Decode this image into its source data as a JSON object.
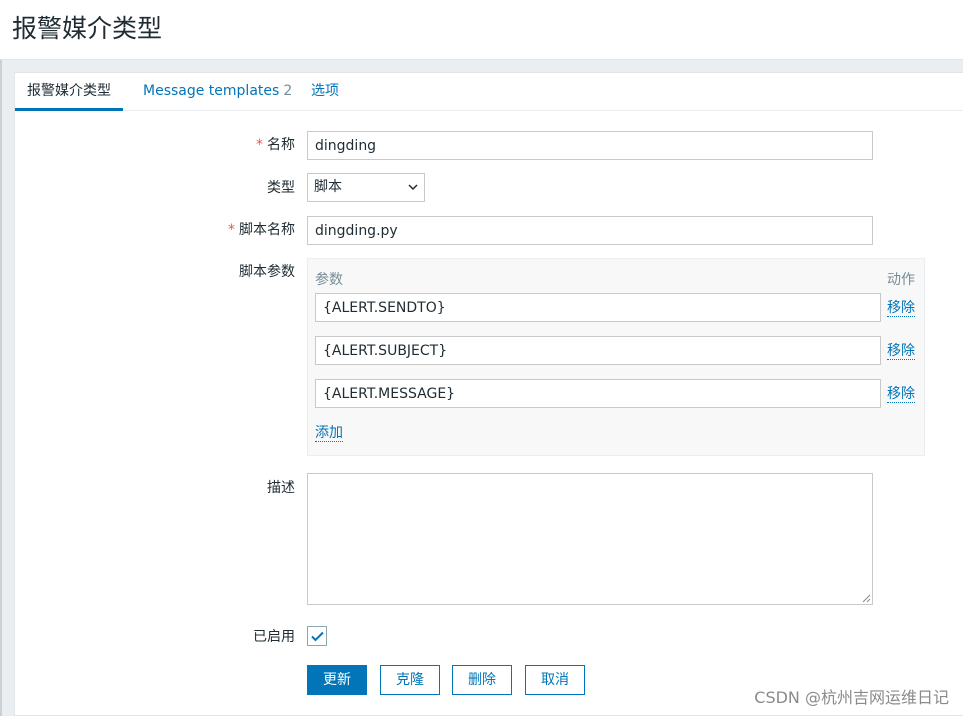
{
  "page": {
    "title": "报警媒介类型"
  },
  "tabs": [
    {
      "label": "报警媒介类型"
    },
    {
      "label": "Message templates",
      "count": "2"
    },
    {
      "label": "选项"
    }
  ],
  "form": {
    "name": {
      "label": "名称",
      "value": "dingding"
    },
    "type": {
      "label": "类型",
      "value": "脚本"
    },
    "script_name": {
      "label": "脚本名称",
      "value": "dingding.py"
    },
    "script_params": {
      "label": "脚本参数",
      "col_param": "参数",
      "col_action": "动作",
      "items": [
        {
          "value": "{ALERT.SENDTO}",
          "action": "移除"
        },
        {
          "value": "{ALERT.SUBJECT}",
          "action": "移除"
        },
        {
          "value": "{ALERT.MESSAGE}",
          "action": "移除"
        }
      ],
      "add_label": "添加"
    },
    "description": {
      "label": "描述",
      "value": ""
    },
    "enabled": {
      "label": "已启用",
      "checked": true
    }
  },
  "buttons": {
    "update": "更新",
    "clone": "克隆",
    "delete": "删除",
    "cancel": "取消"
  },
  "watermark": "CSDN @杭州吉网运维日记",
  "colors": {
    "accent": "#0275b8",
    "required": "#e45959",
    "text": "#1f2c33",
    "muted": "#768d99"
  }
}
